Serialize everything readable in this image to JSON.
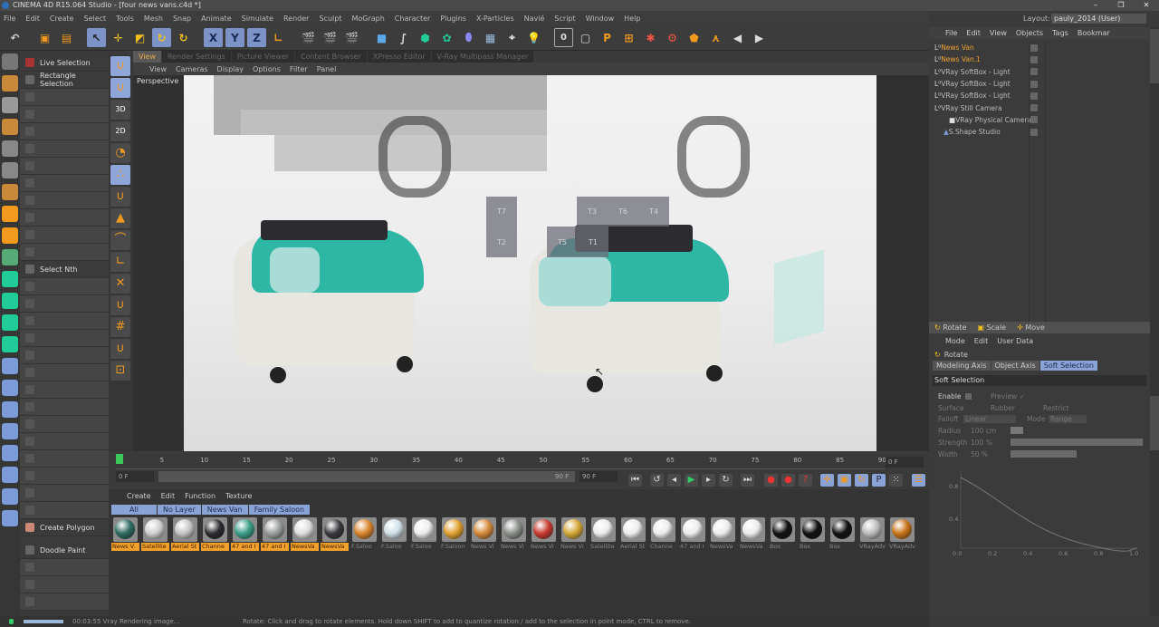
{
  "window": {
    "title": "CINEMA 4D R15.064 Studio - [four news vans.c4d *]",
    "controls": [
      "–",
      "❐",
      "✕"
    ]
  },
  "menu": [
    "File",
    "Edit",
    "Create",
    "Select",
    "Tools",
    "Mesh",
    "Snap",
    "Animate",
    "Simulate",
    "Render",
    "Sculpt",
    "MoGraph",
    "Character",
    "Plugins",
    "X-Particles",
    "Navié",
    "Script",
    "Window",
    "Help"
  ],
  "layout": {
    "label": "Layout:",
    "value": "pauly_2014 (User)"
  },
  "toolbar": {
    "axis": [
      "X",
      "Y",
      "Z"
    ],
    "counter": "0"
  },
  "palette": {
    "top": [
      "Live Selection",
      "Rectangle Selection"
    ],
    "select_nth": "Select Nth",
    "create_polygon": "Create Polygon",
    "doodle_paint": "Doodle Paint"
  },
  "snap": {
    "labels": [
      "3D",
      "2D"
    ]
  },
  "viewport": {
    "tabs": [
      "View",
      "Render Settings",
      "Picture Viewer",
      "Content Browser",
      "XPresso Editor",
      "V-Ray Multipass Manager"
    ],
    "menu": [
      "View",
      "Cameras",
      "Display",
      "Options",
      "Filter",
      "Panel"
    ],
    "camera_label": "Perspective",
    "tiles": [
      "T7",
      "T3",
      "T6",
      "T4",
      "T2",
      "T5",
      "T1"
    ]
  },
  "timeline": {
    "ticks": [
      "0",
      "5",
      "10",
      "15",
      "20",
      "25",
      "30",
      "35",
      "40",
      "45",
      "50",
      "55",
      "60",
      "65",
      "70",
      "75",
      "80",
      "85",
      "90"
    ],
    "current_frame": "0 F",
    "start": "0 F",
    "end": "90 F",
    "range_end": "90 F",
    "end_field": "0 F"
  },
  "materials": {
    "menu": [
      "Create",
      "Edit",
      "Function",
      "Texture"
    ],
    "filters": [
      "All",
      "No Layer",
      "News Van",
      "Family Saloon"
    ],
    "items": [
      {
        "name": "News V.",
        "color": "#2e6b60",
        "on": true
      },
      {
        "name": "Satellite",
        "color": "#cfcfcf",
        "on": true
      },
      {
        "name": "Aerial St",
        "color": "#c4c4c4",
        "on": true
      },
      {
        "name": "Channe",
        "color": "#2c2c30",
        "on": true
      },
      {
        "name": "47 and I",
        "color": "#3a9e88",
        "on": true
      },
      {
        "name": "47 and I",
        "color": "#9aa09c",
        "on": true
      },
      {
        "name": "NewsVa",
        "color": "#dedede",
        "on": true
      },
      {
        "name": "NewsVa",
        "color": "#3a3a3e",
        "on": true
      },
      {
        "name": "F.Saloo",
        "color": "#d9852c",
        "on": false
      },
      {
        "name": "F.Saloo",
        "color": "#cfe0e6",
        "on": false
      },
      {
        "name": "F.Saloo",
        "color": "#ececec",
        "on": false
      },
      {
        "name": "F.Saloon",
        "color": "#e0a030",
        "on": false
      },
      {
        "name": "News Vi",
        "color": "#d48a38",
        "on": false
      },
      {
        "name": "News Vi",
        "color": "#8a9088",
        "on": false
      },
      {
        "name": "News Vi",
        "color": "#c83a30",
        "on": false
      },
      {
        "name": "News Vi",
        "color": "#d4a838",
        "on": false
      },
      {
        "name": "Satellite",
        "color": "#ececec",
        "on": false
      },
      {
        "name": "Aerial St",
        "color": "#ececec",
        "on": false
      },
      {
        "name": "Channe",
        "color": "#ececec",
        "on": false
      },
      {
        "name": "47 and I",
        "color": "#ececec",
        "on": false
      },
      {
        "name": "NewsVa",
        "color": "#ececec",
        "on": false
      },
      {
        "name": "NewsVa",
        "color": "#ececec",
        "on": false
      },
      {
        "name": "Box",
        "color": "#111111",
        "on": false
      },
      {
        "name": "Box",
        "color": "#111111",
        "on": false
      },
      {
        "name": "Box",
        "color": "#111111",
        "on": false
      },
      {
        "name": "VRayAdv",
        "color": "#bbbbbb",
        "on": false
      },
      {
        "name": "VRayAdv",
        "color": "#c8741a",
        "on": false
      }
    ]
  },
  "status": {
    "render": "00:03:55 Vray Rendering image...",
    "hint": "Rotate: Click and drag to rotate elements. Hold down SHIFT to add to quantize rotation / add to the selection in point mode, CTRL to remove."
  },
  "objects": {
    "menu": [
      "File",
      "Edit",
      "View",
      "Objects",
      "Tags",
      "Bookmar"
    ],
    "items": [
      {
        "name": "News Van",
        "hl": true
      },
      {
        "name": "News Van.1",
        "hl": true
      },
      {
        "name": "VRay SoftBox - Light",
        "hl": false
      },
      {
        "name": "VRay SoftBox - Light",
        "hl": false
      },
      {
        "name": "VRay SoftBox - Light",
        "hl": false
      },
      {
        "name": "VRay Still Camera",
        "hl": false
      },
      {
        "name": "VRay Physical Camera",
        "hl": false
      },
      {
        "name": "S.Shape Studio",
        "hl": false
      }
    ]
  },
  "attributes": {
    "tools": [
      "Rotate",
      "Scale",
      "Move"
    ],
    "menu": [
      "Mode",
      "Edit",
      "User Data"
    ],
    "title": "Rotate",
    "tabs": [
      "Modeling Axis",
      "Object Axis",
      "Soft Selection"
    ],
    "section": "Soft Selection",
    "enable": "Enable",
    "preview": "Preview ✓",
    "surface": "Surface",
    "rubber": "Rubber",
    "restrict": "Restrict",
    "falloff": "Falloff",
    "falloff_val": "Linear",
    "mode": "Mode",
    "mode_val": "Range",
    "radius": "Radius",
    "radius_val": "100 cm",
    "strength": "Strength",
    "strength_val": "100 %",
    "width": "Width",
    "width_val": "50 %",
    "graph_x": [
      "0.0",
      "0.2",
      "0.4",
      "0.6",
      "0.8",
      "1.0"
    ],
    "graph_y": [
      "0.8",
      "0.4"
    ]
  }
}
